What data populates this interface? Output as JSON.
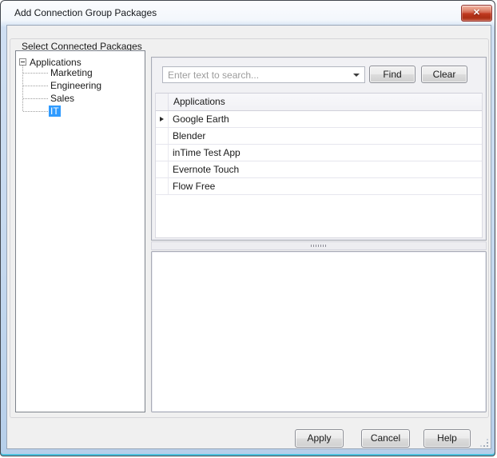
{
  "window": {
    "title": "Add Connection Group Packages",
    "close_glyph": "✕"
  },
  "group": {
    "label": "Select Connected Packages"
  },
  "tree": {
    "root_label": "Applications",
    "items": [
      {
        "label": "Marketing",
        "selected": false
      },
      {
        "label": "Engineering",
        "selected": false
      },
      {
        "label": "Sales",
        "selected": false
      },
      {
        "label": "IT",
        "selected": true
      }
    ]
  },
  "search": {
    "placeholder": "Enter text to search...",
    "value": "",
    "find_label": "Find",
    "clear_label": "Clear"
  },
  "grid": {
    "column_header": "Applications",
    "current_row": "Google Earth",
    "rows": [
      {
        "name": "Google Earth",
        "current": true
      },
      {
        "name": "Blender",
        "current": false
      },
      {
        "name": "inTime Test App",
        "current": false
      },
      {
        "name": "Evernote Touch",
        "current": false
      },
      {
        "name": "Flow Free",
        "current": false
      }
    ]
  },
  "footer": {
    "apply_label": "Apply",
    "cancel_label": "Cancel",
    "help_label": "Help"
  },
  "colors": {
    "selection_blue": "#2f9bff",
    "close_red": "#c13a20",
    "client_bg": "#f0f0f0",
    "glass_blue": "#c6d9ef"
  }
}
